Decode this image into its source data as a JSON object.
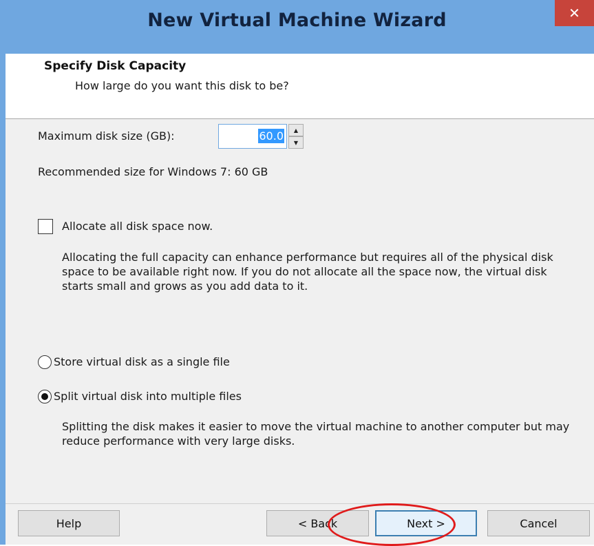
{
  "window": {
    "title": "New Virtual Machine Wizard",
    "close_glyph": "✕"
  },
  "header": {
    "title": "Specify Disk Capacity",
    "subtitle": "How large do you want this disk to be?"
  },
  "disk_size": {
    "label": "Maximum disk size (GB):",
    "value": "60.0",
    "recommended": "Recommended size for Windows 7: 60 GB"
  },
  "allocate": {
    "label": "Allocate all disk space now.",
    "checked": false,
    "description": "Allocating the full capacity can enhance performance but requires all of the physical disk space to be available right now. If you do not allocate all the space now, the virtual disk starts small and grows as you add data to it."
  },
  "storage_options": [
    {
      "label": "Store virtual disk as a single file",
      "selected": false
    },
    {
      "label": "Split virtual disk into multiple files",
      "selected": true
    }
  ],
  "split_description": "Splitting the disk makes it easier to move the virtual machine to another computer but may reduce performance with very large disks.",
  "buttons": {
    "help": "Help",
    "back": "< Back",
    "next": "Next >",
    "cancel": "Cancel"
  },
  "icons": {
    "spin_up": "▲",
    "spin_down": "▼"
  },
  "colors": {
    "titlebar": "#6fa7e0",
    "close": "#c7443b",
    "annotation": "#e01b1b"
  }
}
